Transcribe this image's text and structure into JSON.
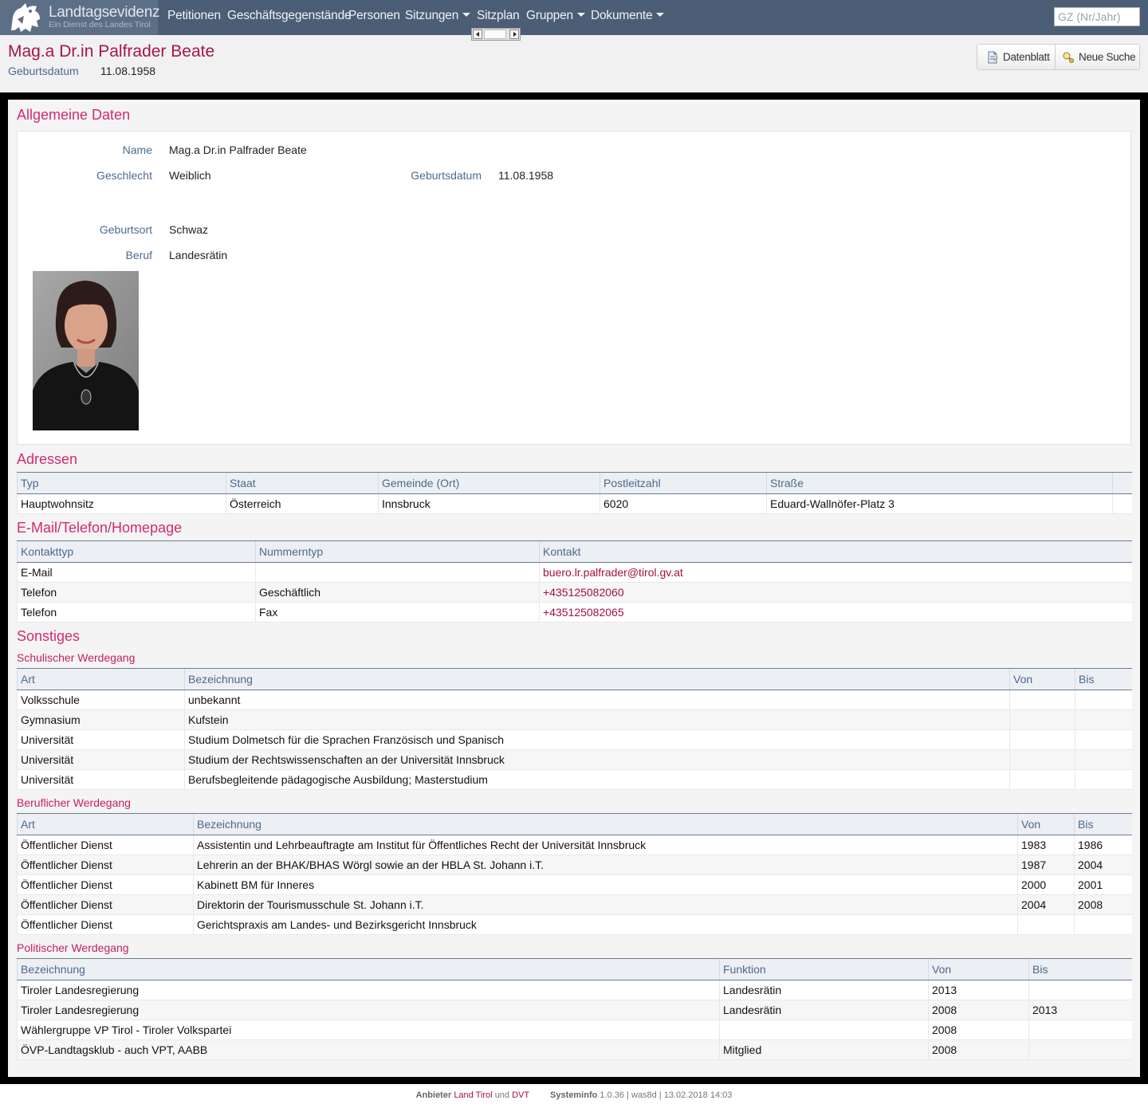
{
  "nav": {
    "brand_title": "Landtagsevidenz",
    "brand_subtitle": "Ein Dienst des Landes Tirol",
    "items": [
      "Petitionen",
      "Geschäftsgegenstände",
      "Personen",
      "Sitzungen",
      "Sitzplan",
      "Gruppen",
      "Dokumente"
    ],
    "search_placeholder": "GZ (Nr/Jahr)"
  },
  "header": {
    "title": "Mag.a Dr.in Palfrader Beate",
    "birth_label": "Geburtsdatum",
    "birth_value": "11.08.1958",
    "buttons": [
      "Datenblatt",
      "Neue Suche"
    ]
  },
  "general": {
    "title": "Allgemeine Daten",
    "name_label": "Name",
    "name_value": "Mag.a Dr.in Palfrader Beate",
    "gender_label": "Geschlecht",
    "gender_value": "Weiblich",
    "birthdate_label": "Geburtsdatum",
    "birthdate_value": "11.08.1958",
    "birthplace_label": "Geburtsort",
    "birthplace_value": "Schwaz",
    "job_label": "Beruf",
    "job_value": "Landesrätin"
  },
  "addresses": {
    "title": "Adressen",
    "headers": [
      "Typ",
      "Staat",
      "Gemeinde (Ort)",
      "Postleitzahl",
      "Straße"
    ],
    "rows": [
      [
        "Hauptwohnsitz",
        "Österreich",
        "Innsbruck",
        "6020",
        "Eduard-Wallnöfer-Platz 3"
      ]
    ]
  },
  "contacts": {
    "title": "E-Mail/Telefon/Homepage",
    "headers": [
      "Kontakttyp",
      "Nummerntyp",
      "Kontakt"
    ],
    "rows": [
      [
        "E-Mail",
        "",
        "buero.lr.palfrader@tirol.gv.at"
      ],
      [
        "Telefon",
        "Geschäftlich",
        "+435125082060"
      ],
      [
        "Telefon",
        "Fax",
        "+435125082065"
      ]
    ]
  },
  "misc": {
    "title": "Sonstiges",
    "school": {
      "title": "Schulischer Werdegang",
      "headers": [
        "Art",
        "Bezeichnung",
        "Von",
        "Bis"
      ],
      "rows": [
        [
          "Volksschule",
          "unbekannt",
          "",
          ""
        ],
        [
          "Gymnasium",
          "Kufstein",
          "",
          ""
        ],
        [
          "Universität",
          "Studium Dolmetsch für die Sprachen Französisch und Spanisch",
          "",
          ""
        ],
        [
          "Universität",
          "Studium der Rechtswissenschaften an der Universität Innsbruck",
          "",
          ""
        ],
        [
          "Universität",
          "Berufsbegleitende pädagogische Ausbildung; Masterstudium",
          "",
          ""
        ]
      ]
    },
    "career": {
      "title": "Beruflicher Werdegang",
      "headers": [
        "Art",
        "Bezeichnung",
        "Von",
        "Bis"
      ],
      "rows": [
        [
          "Öffentlicher Dienst",
          "Assistentin und Lehrbeauftragte am Institut für Öffentliches Recht der Universität Innsbruck",
          "1983",
          "1986"
        ],
        [
          "Öffentlicher Dienst",
          "Lehrerin an der BHAK/BHAS Wörgl sowie an der HBLA St. Johann i.T.",
          "1987",
          "2004"
        ],
        [
          "Öffentlicher Dienst",
          "Kabinett BM für Inneres",
          "2000",
          "2001"
        ],
        [
          "Öffentlicher Dienst",
          "Direktorin der Tourismusschule St. Johann i.T.",
          "2004",
          "2008"
        ],
        [
          "Öffentlicher Dienst",
          "Gerichtspraxis am Landes- und Bezirksgericht Innsbruck",
          "",
          ""
        ]
      ]
    },
    "politics": {
      "title": "Politischer Werdegang",
      "headers": [
        "Bezeichnung",
        "Funktion",
        "Von",
        "Bis"
      ],
      "rows": [
        [
          "Tiroler Landesregierung",
          "Landesrätin",
          "2013",
          ""
        ],
        [
          "Tiroler Landesregierung",
          "Landesrätin",
          "2008",
          "2013"
        ],
        [
          "Wählergruppe VP Tirol - Tiroler Volkspartei",
          "",
          "2008",
          ""
        ],
        [
          "ÖVP-Landtagsklub - auch VPT, AABB",
          "Mitglied",
          "2008",
          ""
        ]
      ]
    }
  },
  "footer": {
    "provider_label": "Anbieter",
    "provider_link1": "Land Tirol",
    "and": "und",
    "provider_link2": "DVT",
    "sysinfo_label": "Systeminfo",
    "sysinfo_value": "1.0.36 | was8d | 13.02.2018 14:03"
  },
  "colors": {
    "nav_bg": "#4b5e75",
    "accent": "#d12c6e",
    "title": "#a8154d",
    "label": "#4d6a8c",
    "link": "#a4123e"
  }
}
